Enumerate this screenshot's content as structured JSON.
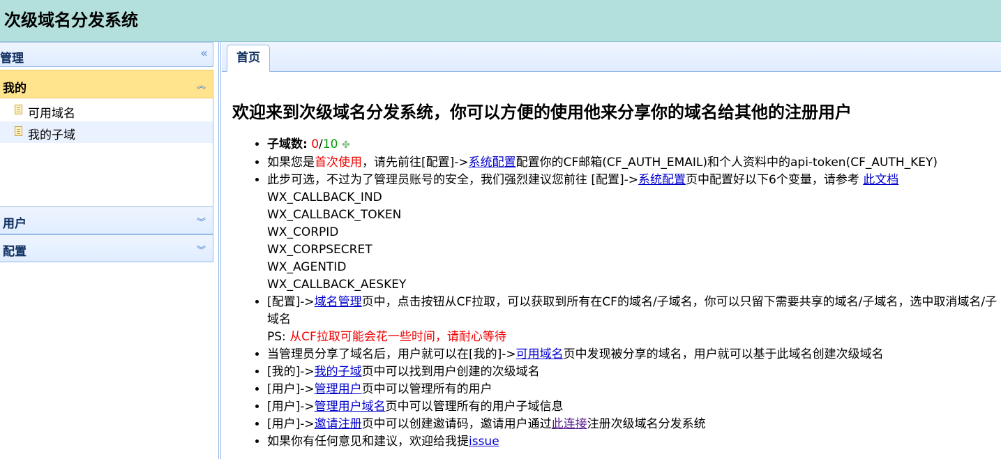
{
  "app": {
    "title": "次级域名分发系统"
  },
  "sidebar": {
    "header": "管理",
    "panels": {
      "mine": {
        "title": "我的",
        "items": [
          {
            "label": "可用域名"
          },
          {
            "label": "我的子域"
          }
        ]
      },
      "user": {
        "title": "用户"
      },
      "config": {
        "title": "配置"
      }
    }
  },
  "tabs": [
    {
      "label": "首页"
    }
  ],
  "main": {
    "welcome": "欢迎来到次级域名分发系统，你可以方便的使用他来分享你的域名给其他的注册用户",
    "subdomain": {
      "label": "子域数:",
      "used": "0",
      "sep": "/",
      "limit": "10"
    },
    "first_use": {
      "pre": "如果您是",
      "highlight": "首次使用",
      "mid": "，请先前往[配置]->",
      "link": "系统配置",
      "post": "配置你的CF邮箱(CF_AUTH_EMAIL)和个人资料中的api-token(CF_AUTH_KEY)"
    },
    "optional": {
      "pre": "此步可选，不过为了管理员账号的安全，我们强烈建议您前往 [配置]->",
      "link": "系统配置",
      "mid": "页中配置好以下6个变量，请参考 ",
      "doc_link": "此文档",
      "vars": [
        "WX_CALLBACK_IND",
        "WX_CALLBACK_TOKEN",
        "WX_CORPID",
        "WX_CORPSECRET",
        "WX_AGENTID",
        "WX_CALLBACK_AESKEY"
      ]
    },
    "domain_mgmt": {
      "pre": "[配置]->",
      "link": "域名管理",
      "post": "页中，点击按钮从CF拉取，可以获取到所有在CF的域名/子域名，你可以只留下需要共享的域名/子域名，选中取消域名/子域名",
      "ps_label": "PS: ",
      "ps_text": "从CF拉取可能会花一些时间，请耐心等待"
    },
    "share": {
      "pre": "当管理员分享了域名后，用户就可以在[我的]->",
      "link": "可用域名",
      "post": "页中发现被分享的域名，用户就可以基于此域名创建次级域名"
    },
    "my_sub": {
      "pre": "[我的]->",
      "link": "我的子域",
      "post": "页中可以找到用户创建的次级域名"
    },
    "manage_users": {
      "pre": "[用户]->",
      "link": "管理用户",
      "post": "页中可以管理所有的用户"
    },
    "manage_user_domains": {
      "pre": "[用户]->",
      "link": "管理用户域名",
      "post": "页中可以管理所有的用户子域信息"
    },
    "invite": {
      "pre": "[用户]->",
      "link": "邀请注册",
      "mid": "页中可以创建邀请码，邀请用户通过",
      "link2": "此连接",
      "post": "注册次级域名分发系统"
    },
    "feedback": {
      "pre": "如果你有任何意见和建议，欢迎给我提",
      "link": "issue"
    }
  }
}
